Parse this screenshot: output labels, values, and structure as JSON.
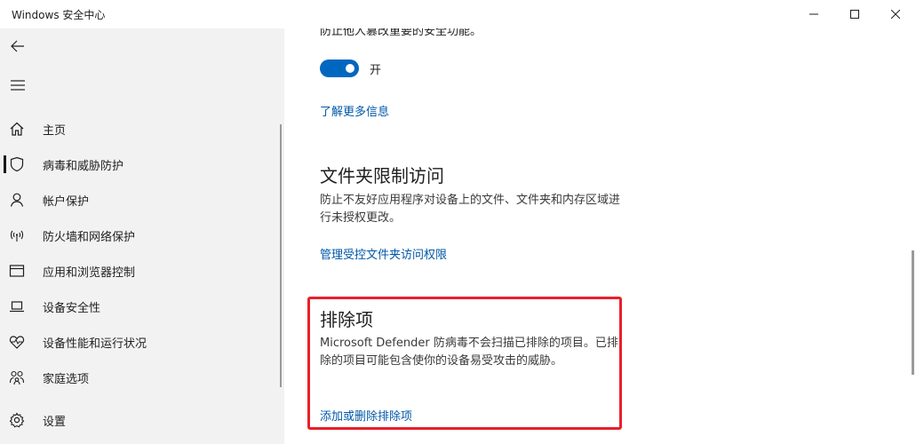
{
  "window": {
    "title": "Windows 安全中心"
  },
  "sidebar": {
    "items": [
      {
        "label": "主页",
        "icon": "home-icon"
      },
      {
        "label": "病毒和威胁防护",
        "icon": "shield-icon",
        "active": true
      },
      {
        "label": "帐户保护",
        "icon": "person-icon"
      },
      {
        "label": "防火墙和网络保护",
        "icon": "wifi-antenna-icon"
      },
      {
        "label": "应用和浏览器控制",
        "icon": "app-window-icon"
      },
      {
        "label": "设备安全性",
        "icon": "laptop-icon"
      },
      {
        "label": "设备性能和运行状况",
        "icon": "heart-pulse-icon"
      },
      {
        "label": "家庭选项",
        "icon": "family-icon"
      },
      {
        "label": "设置",
        "icon": "gear-icon"
      }
    ]
  },
  "main": {
    "partial_text": "防止他人篡改重要的安全功能。",
    "toggle": {
      "label": "开",
      "state": "on"
    },
    "learn_more_link": "了解更多信息",
    "folder_access": {
      "title": "文件夹限制访问",
      "description": "防止不友好应用程序对设备上的文件、文件夹和内存区域进行未授权更改。",
      "link": "管理受控文件夹访问权限"
    },
    "exclusions": {
      "title": "排除项",
      "description": "Microsoft Defender 防病毒不会扫描已排除的项目。已排除的项目可能包含使你的设备易受攻击的威胁。",
      "link": "添加或删除排除项"
    }
  },
  "colors": {
    "accent": "#0067c0",
    "link": "#0058a8",
    "highlight": "#e8202a",
    "sidebar_bg": "#f2f2f2"
  }
}
